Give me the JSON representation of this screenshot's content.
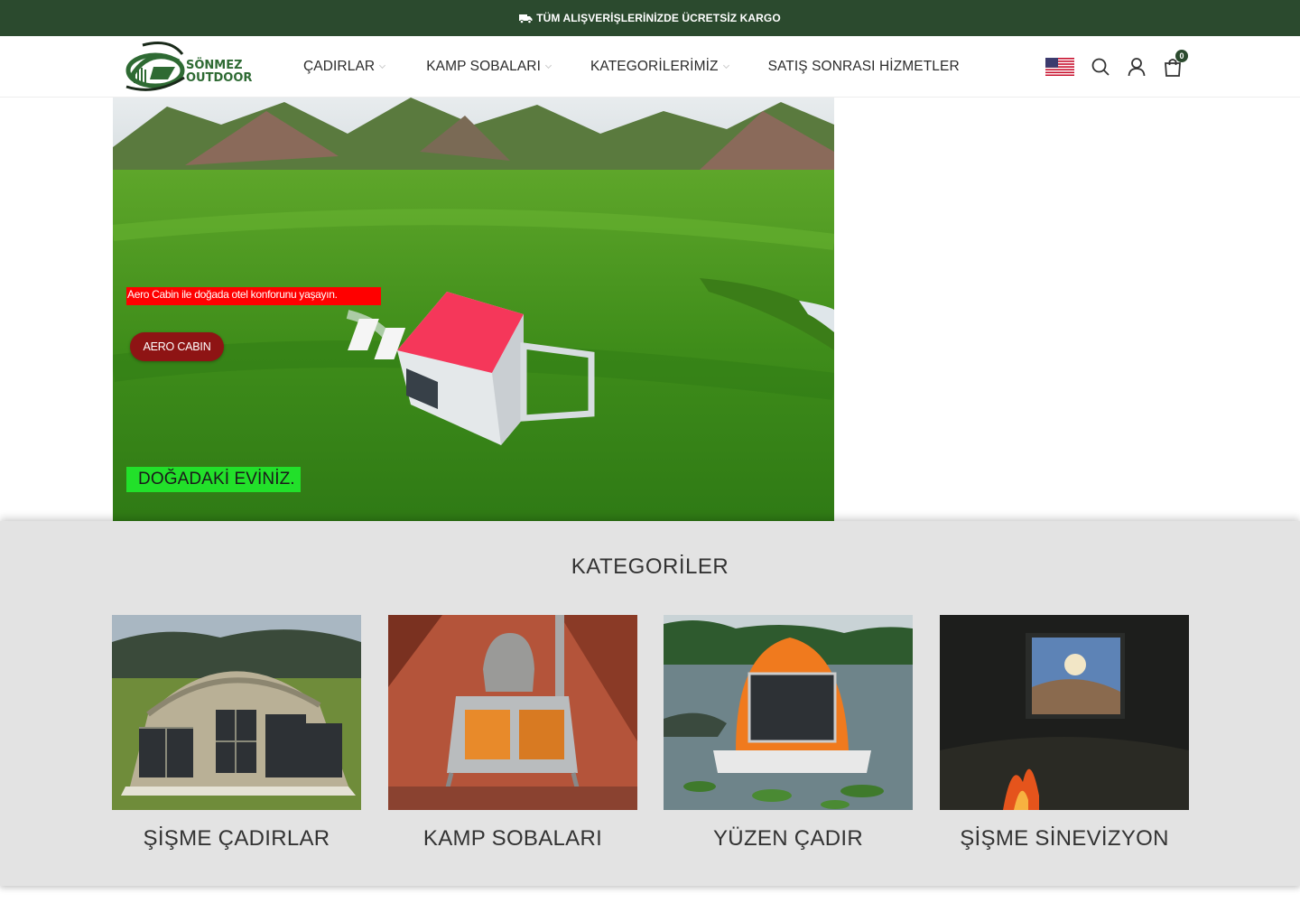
{
  "topbar": {
    "icon": "truck-icon",
    "text": "TÜM ALIŞVERİŞLERİNİZDE ÜCRETSİZ KARGO"
  },
  "header": {
    "logo": {
      "line1": "SÖNMEZ",
      "line2": "OUTDOOR"
    },
    "nav": [
      {
        "label": "ÇADIRLAR",
        "has_dropdown": true
      },
      {
        "label": "KAMP SOBALARI",
        "has_dropdown": true
      },
      {
        "label": "KATEGORİLERİMİZ",
        "has_dropdown": true
      },
      {
        "label": "SATIŞ SONRASI HİZMETLER",
        "has_dropdown": false
      }
    ],
    "icons": [
      "us-flag-icon",
      "search-icon",
      "user-icon",
      "shopping-bag-icon"
    ],
    "cart_count": "0"
  },
  "hero": {
    "tagline": "Aero Cabin ile doğada otel konforunu yaşayın.",
    "button_label": "AERO CABIN",
    "slogan": "DOĞADAKİ EVİNİZ."
  },
  "categories": {
    "title": "KATEGORİLER",
    "items": [
      {
        "label": "ŞİŞME ÇADIRLAR"
      },
      {
        "label": "KAMP SOBALARI"
      },
      {
        "label": "YÜZEN ÇADIR"
      },
      {
        "label": "ŞİŞME SİNEVİZYON"
      }
    ]
  },
  "colors": {
    "topbar_bg": "#2b4a2e",
    "brand_green": "#2e6a33",
    "tagline_bg": "#ff0000",
    "button_bg": "#8e1414",
    "slogan_bg": "#22e02a",
    "section_bg": "#e3e3e3"
  }
}
